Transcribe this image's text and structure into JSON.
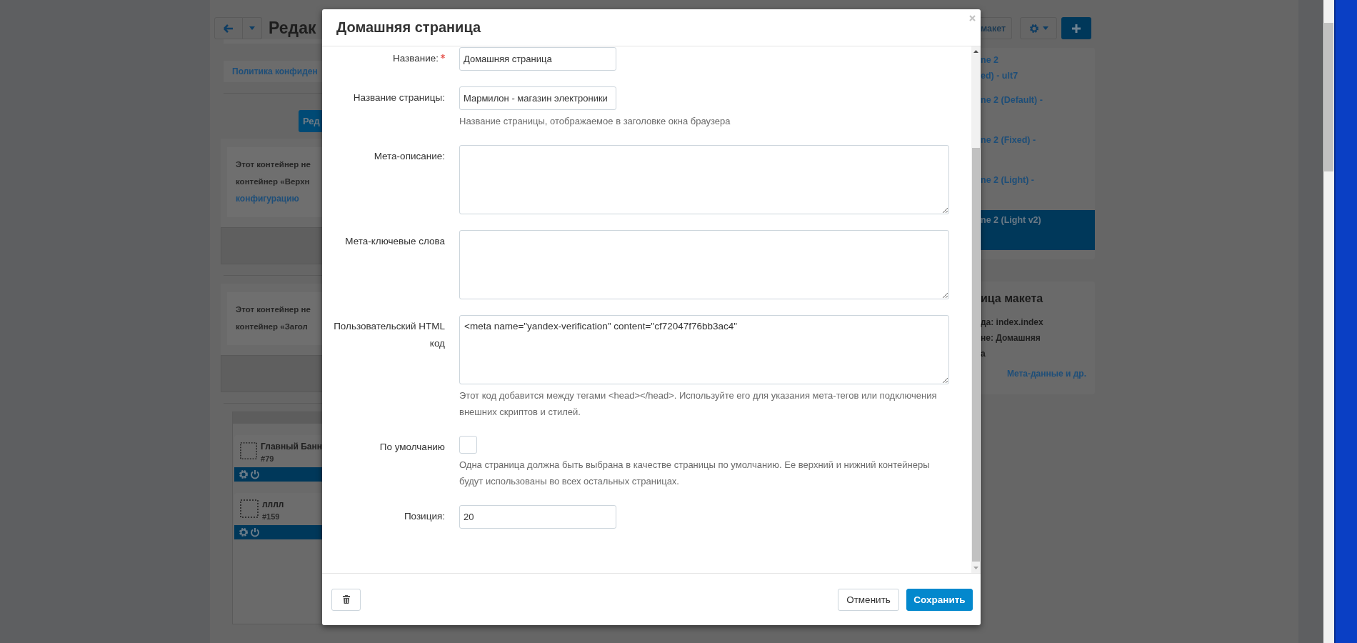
{
  "background": {
    "left": {
      "title": "Редак",
      "link_box": "Политика конфиден",
      "edit_button": "Ред",
      "containers": [
        {
          "lines": [
            "Этот контейнер не",
            "контейнер «Верхн"
          ],
          "link": "конфигурацию"
        },
        {
          "lines": [
            "Этот контейнер не",
            "контейнер «Загол"
          ]
        }
      ],
      "blocks": [
        {
          "name": "Главный Банн",
          "id": "#79"
        },
        {
          "name": "лллл",
          "id": "#159"
        }
      ]
    },
    "right": {
      "layout_button": "макет",
      "layouts": [
        {
          "lines": [
            "ne 2",
            "ed) - ult7"
          ],
          "selected": false
        },
        {
          "lines": [
            "ne 2 (Default) -"
          ],
          "selected": false
        },
        {
          "lines": [
            "ne 2 (Fixed) -"
          ],
          "selected": false
        },
        {
          "lines": [
            "ne 2 (Light) -"
          ],
          "selected": false
        },
        {
          "lines": [
            "ne 2 (Light v2)"
          ],
          "selected": true
        }
      ],
      "panel": {
        "title": "ица макета",
        "lines": [
          "да: index.index",
          "не: Домашняя",
          "а"
        ],
        "link": "Мета-данные и др."
      }
    }
  },
  "modal": {
    "title": "Домашняя страница",
    "fields": [
      {
        "kind": "input",
        "label": "Название:",
        "required": true,
        "value": "Домашняя страница"
      },
      {
        "kind": "input",
        "label": "Название страницы:",
        "required": false,
        "value": "Мармилон - магазин электроники",
        "help": "Название страницы, отображаемое в заголовке окна браузера"
      },
      {
        "kind": "textarea",
        "label": "Мета-описание:",
        "required": false
      },
      {
        "kind": "textarea",
        "label": "Мета-ключевые слова",
        "required": false
      },
      {
        "kind": "textarea",
        "label": "Пользовательский HTML код",
        "required": false,
        "value": "<meta name=\"yandex-verification\" content=\"cf72047f76bb3ac4\"",
        "help": "Этот код добавится между тегами <head></head>. Используйте его для указания мета-тегов или подключения внешних скриптов и стилей."
      },
      {
        "kind": "checkbox",
        "label": "По умолчанию",
        "required": false,
        "checked": false,
        "help": "Одна страница должна быть выбрана в качестве страницы по умолчанию. Ее верхний и нижний контейнеры будут использованы во всех остальных страницах."
      },
      {
        "kind": "input",
        "label": "Позиция:",
        "required": false,
        "value": "20"
      }
    ],
    "footer": {
      "cancel": "Отменить",
      "save": "Сохранить"
    }
  }
}
